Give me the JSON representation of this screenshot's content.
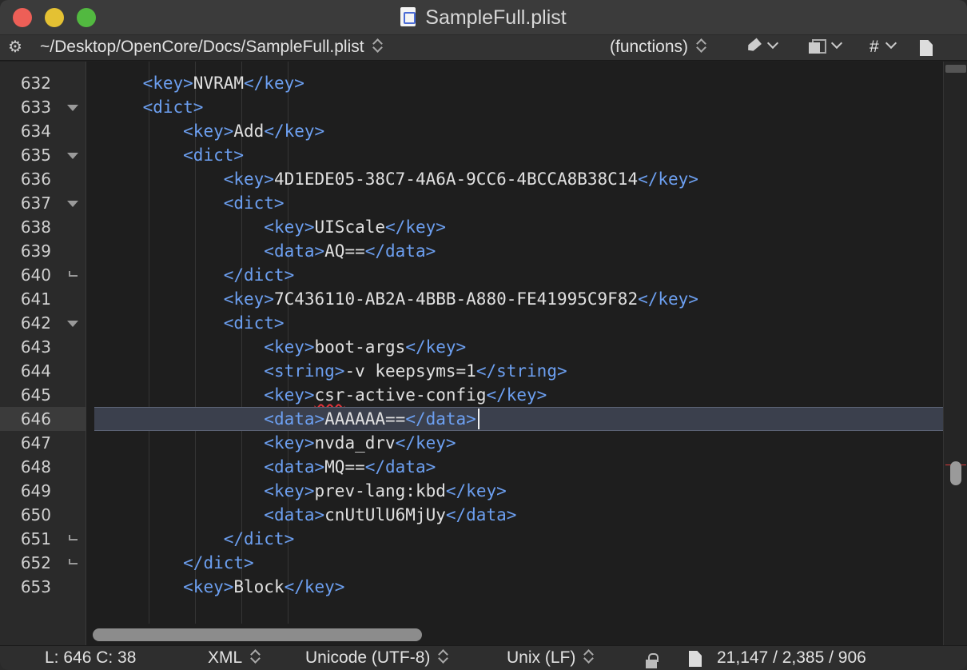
{
  "window": {
    "title": "SampleFull.plist"
  },
  "navbar": {
    "path": "~/Desktop/OpenCore/Docs/SampleFull.plist",
    "functions": "(functions)",
    "hash": "#"
  },
  "editor": {
    "current_line": 646,
    "lines": [
      {
        "num": "632",
        "fold": "",
        "indent": "    ",
        "segments": [
          [
            "tag",
            "<key>"
          ],
          [
            "text",
            "NVRAM"
          ],
          [
            "tag",
            "</key>"
          ]
        ]
      },
      {
        "num": "633",
        "fold": "open",
        "indent": "    ",
        "segments": [
          [
            "tag",
            "<dict>"
          ]
        ]
      },
      {
        "num": "634",
        "fold": "",
        "indent": "        ",
        "segments": [
          [
            "tag",
            "<key>"
          ],
          [
            "text",
            "Add"
          ],
          [
            "tag",
            "</key>"
          ]
        ]
      },
      {
        "num": "635",
        "fold": "open",
        "indent": "        ",
        "segments": [
          [
            "tag",
            "<dict>"
          ]
        ]
      },
      {
        "num": "636",
        "fold": "",
        "indent": "            ",
        "segments": [
          [
            "tag",
            "<key>"
          ],
          [
            "text",
            "4D1EDE05-38C7-4A6A-9CC6-4BCCA8B38C14"
          ],
          [
            "tag",
            "</key>"
          ]
        ]
      },
      {
        "num": "637",
        "fold": "open",
        "indent": "            ",
        "segments": [
          [
            "tag",
            "<dict>"
          ]
        ]
      },
      {
        "num": "638",
        "fold": "",
        "indent": "                ",
        "segments": [
          [
            "tag",
            "<key>"
          ],
          [
            "text",
            "UIScale"
          ],
          [
            "tag",
            "</key>"
          ]
        ]
      },
      {
        "num": "639",
        "fold": "",
        "indent": "                ",
        "segments": [
          [
            "tag",
            "<data>"
          ],
          [
            "text",
            "AQ=="
          ],
          [
            "tag",
            "</data>"
          ]
        ]
      },
      {
        "num": "640",
        "fold": "close",
        "indent": "            ",
        "segments": [
          [
            "tag",
            "</dict>"
          ]
        ]
      },
      {
        "num": "641",
        "fold": "",
        "indent": "            ",
        "segments": [
          [
            "tag",
            "<key>"
          ],
          [
            "text",
            "7C436110-AB2A-4BBB-A880-FE41995C9F82"
          ],
          [
            "tag",
            "</key>"
          ]
        ]
      },
      {
        "num": "642",
        "fold": "open",
        "indent": "            ",
        "segments": [
          [
            "tag",
            "<dict>"
          ]
        ]
      },
      {
        "num": "643",
        "fold": "",
        "indent": "                ",
        "segments": [
          [
            "tag",
            "<key>"
          ],
          [
            "text",
            "boot-args"
          ],
          [
            "tag",
            "</key>"
          ]
        ]
      },
      {
        "num": "644",
        "fold": "",
        "indent": "                ",
        "segments": [
          [
            "tag",
            "<string>"
          ],
          [
            "text",
            "-v keepsyms=1"
          ],
          [
            "tag",
            "</string>"
          ]
        ]
      },
      {
        "num": "645",
        "fold": "",
        "indent": "                ",
        "segments": [
          [
            "tag",
            "<key>"
          ],
          [
            "squiggle",
            "csr"
          ],
          [
            "text",
            "-active-config"
          ],
          [
            "tag",
            "</key>"
          ]
        ]
      },
      {
        "num": "646",
        "fold": "",
        "indent": "                ",
        "segments": [
          [
            "tag",
            "<data>"
          ],
          [
            "text",
            "AAAAAA=="
          ],
          [
            "tag",
            "</data>"
          ]
        ]
      },
      {
        "num": "647",
        "fold": "",
        "indent": "                ",
        "segments": [
          [
            "tag",
            "<key>"
          ],
          [
            "text",
            "nvda_drv"
          ],
          [
            "tag",
            "</key>"
          ]
        ]
      },
      {
        "num": "648",
        "fold": "",
        "indent": "                ",
        "segments": [
          [
            "tag",
            "<data>"
          ],
          [
            "text",
            "MQ=="
          ],
          [
            "tag",
            "</data>"
          ]
        ]
      },
      {
        "num": "649",
        "fold": "",
        "indent": "                ",
        "segments": [
          [
            "tag",
            "<key>"
          ],
          [
            "text",
            "prev-lang:kbd"
          ],
          [
            "tag",
            "</key>"
          ]
        ]
      },
      {
        "num": "650",
        "fold": "",
        "indent": "                ",
        "segments": [
          [
            "tag",
            "<data>"
          ],
          [
            "text",
            "cnUtUlU6MjUy"
          ],
          [
            "tag",
            "</data>"
          ]
        ]
      },
      {
        "num": "651",
        "fold": "close",
        "indent": "            ",
        "segments": [
          [
            "tag",
            "</dict>"
          ]
        ]
      },
      {
        "num": "652",
        "fold": "close",
        "indent": "        ",
        "segments": [
          [
            "tag",
            "</dict>"
          ]
        ]
      },
      {
        "num": "653",
        "fold": "",
        "indent": "        ",
        "segments": [
          [
            "tag",
            "<key>"
          ],
          [
            "text",
            "Block"
          ],
          [
            "tag",
            "</key>"
          ]
        ]
      }
    ]
  },
  "statusbar": {
    "position": "L: 646 C: 38",
    "syntax": "XML",
    "encoding": "Unicode (UTF-8)",
    "line_endings": "Unix (LF)",
    "counts": "21,147 / 2,385 / 906"
  },
  "colors": {
    "tag": "#6c9ff0",
    "text": "#e0e0e0",
    "current_line": "#3b404d",
    "squiggle": "#e0333a"
  }
}
